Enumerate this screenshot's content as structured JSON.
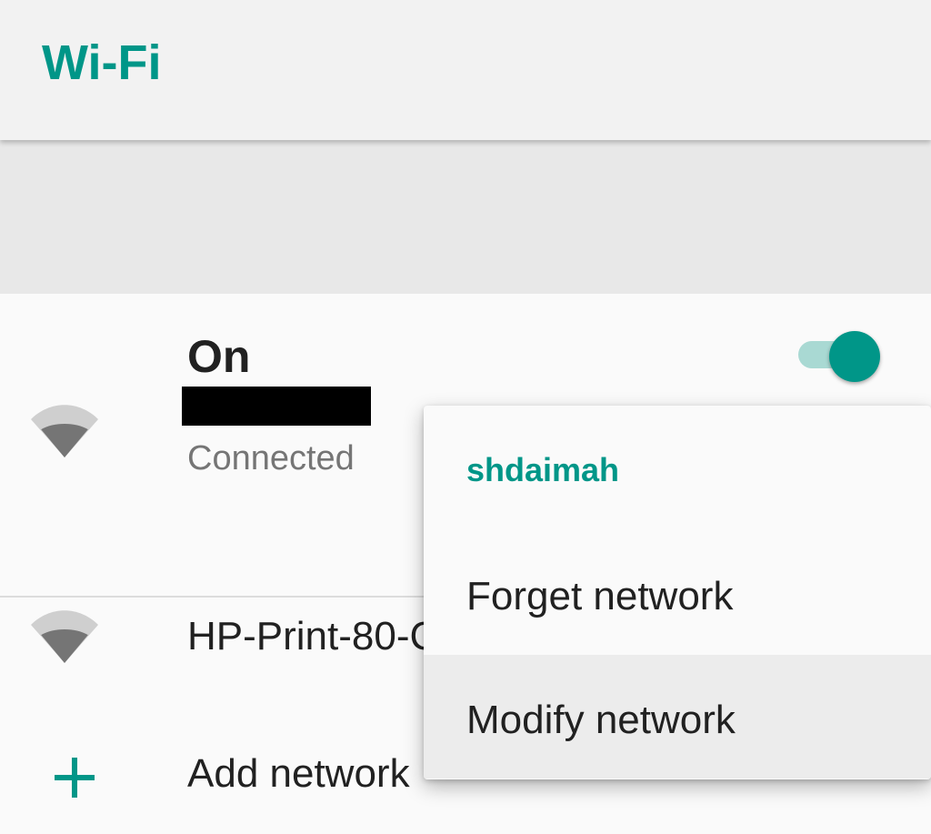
{
  "appbar": {
    "title": "Wi-Fi"
  },
  "master_switch": {
    "label": "On",
    "state": "on",
    "accent_color": "#009688"
  },
  "networks": [
    {
      "ssid": "",
      "ssid_redacted": true,
      "status": "Connected",
      "icon": "wifi-signal-icon",
      "signal_bars": 3
    },
    {
      "ssid": "HP-Print-80-C",
      "status": "",
      "icon": "wifi-signal-icon",
      "signal_bars": 3
    }
  ],
  "add_network": {
    "label": "Add network",
    "icon": "add-icon"
  },
  "context_menu": {
    "title": "shdaimah",
    "items": [
      {
        "label": "Forget network"
      },
      {
        "label": "Modify network",
        "highlighted": true
      }
    ]
  },
  "colors": {
    "accent": "#009688",
    "text_primary": "#212121",
    "text_secondary": "#757575"
  }
}
